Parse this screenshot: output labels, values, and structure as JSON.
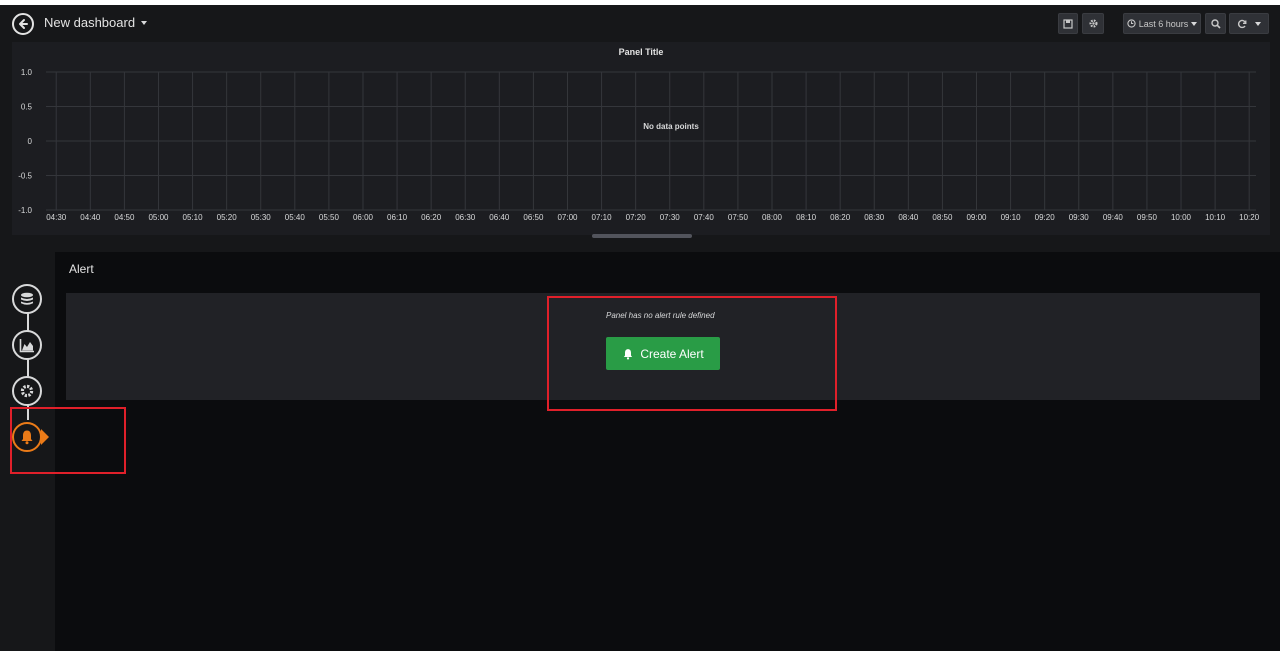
{
  "navbar": {
    "title": "New dashboard",
    "time_range": "Last 6 hours"
  },
  "graph": {
    "title": "Panel Title",
    "empty_text": "No data points"
  },
  "chart_data": {
    "type": "line",
    "title": "Panel Title",
    "x": [
      "04:30",
      "04:40",
      "04:50",
      "05:00",
      "05:10",
      "05:20",
      "05:30",
      "05:40",
      "05:50",
      "06:00",
      "06:10",
      "06:20",
      "06:30",
      "06:40",
      "06:50",
      "07:00",
      "07:10",
      "07:20",
      "07:30",
      "07:40",
      "07:50",
      "08:00",
      "08:10",
      "08:20",
      "08:30",
      "08:40",
      "08:50",
      "09:00",
      "09:10",
      "09:20",
      "09:30",
      "09:40",
      "09:50",
      "10:00",
      "10:10",
      "10:20"
    ],
    "series": [],
    "yticks": [
      "1.0",
      "0.5",
      "0",
      "-0.5",
      "-1.0"
    ],
    "ylim": [
      -1.0,
      1.0
    ],
    "grid": true,
    "annotation": "No data points"
  },
  "rail": {
    "steps": [
      {
        "icon": "database-icon"
      },
      {
        "icon": "area-chart-icon"
      },
      {
        "icon": "gear-icon"
      },
      {
        "icon": "bell-icon"
      }
    ]
  },
  "alert": {
    "heading": "Alert",
    "no_rule_text": "Panel has no alert rule defined",
    "create_label": "Create Alert"
  },
  "colors": {
    "accent_orange": "#eb7b18",
    "button_green": "#299c46",
    "highlight_red": "#e0202a"
  }
}
